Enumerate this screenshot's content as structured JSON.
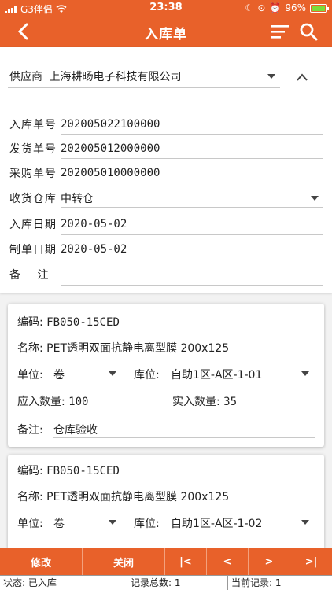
{
  "status_bar": {
    "carrier": "G3伴侣",
    "time": "23:38",
    "battery": "96%"
  },
  "nav": {
    "title": "入库单"
  },
  "header": {
    "supplier_label": "供应商",
    "supplier_value": "上海耕旸电子科技有限公司",
    "fields": [
      {
        "label": "入库单号",
        "value": "202005022100000"
      },
      {
        "label": "发货单号",
        "value": "202005012000000"
      },
      {
        "label": "采购单号",
        "value": "202005010000000"
      },
      {
        "label": "收货仓库",
        "value": "中转仓"
      },
      {
        "label": "入库日期",
        "value": "2020-05-02"
      },
      {
        "label": "制单日期",
        "value": "2020-05-02"
      },
      {
        "label": "备　 注",
        "value": ""
      }
    ]
  },
  "items": [
    {
      "code_label": "编码:",
      "code": "FB050-15CED",
      "name_label": "名称:",
      "name": "PET透明双面抗静电离型膜 200x125",
      "unit_label": "单位:",
      "unit": "卷",
      "location_label": "库位:",
      "location": "自助1区-A区-1-01",
      "expected_label": "应入数量:",
      "expected": "100",
      "actual_label": "实入数量:",
      "actual": "35",
      "remark_label": "备注:",
      "remark": "仓库验收"
    },
    {
      "code_label": "编码:",
      "code": "FB050-15CED",
      "name_label": "名称:",
      "name": "PET透明双面抗静电离型膜 200x125",
      "unit_label": "单位:",
      "unit": "卷",
      "location_label": "库位:",
      "location": "自助1区-A区-1-02"
    }
  ],
  "bottom_bar": {
    "edit": "修改",
    "close": "关闭",
    "first": "|<",
    "prev": "<",
    "next": ">",
    "last": ">|"
  },
  "status_row": {
    "status": "状态: 已入库",
    "total": "记录总数: 1",
    "current": "当前记录: 1"
  },
  "colors": {
    "accent": "#e8612a",
    "battery": "#7bdc3a"
  }
}
